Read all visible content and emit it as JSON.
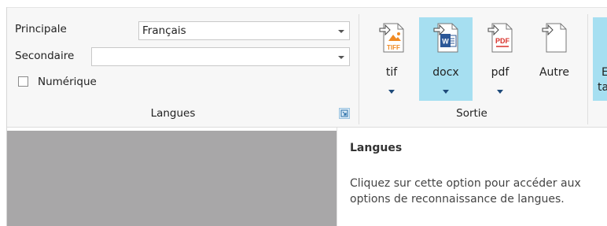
{
  "langues": {
    "principale_label": "Principale",
    "principale_value": "Français",
    "secondaire_label": "Secondaire",
    "secondaire_value": "",
    "numerique_label": "Numérique",
    "group_label": "Langues"
  },
  "sortie": {
    "group_label": "Sortie",
    "formats": [
      {
        "label": "tif",
        "icon": "tiff-file-icon",
        "badge": "TIFF",
        "has_dropdown": true,
        "selected": false
      },
      {
        "label": "docx",
        "icon": "word-file-icon",
        "badge": "W",
        "has_dropdown": true,
        "selected": true
      },
      {
        "label": "pdf",
        "icon": "pdf-file-icon",
        "badge": "PDF",
        "has_dropdown": true,
        "selected": false
      },
      {
        "label": "Autre",
        "icon": "generic-file-icon",
        "badge": "",
        "has_dropdown": false,
        "selected": false
      }
    ]
  },
  "next_group": {
    "label_line1": "E",
    "label_line2": "ta"
  },
  "tooltip": {
    "title": "Langues",
    "body": "Cliquez sur cette option pour accéder aux options de reconnaissance de langues."
  },
  "colors": {
    "ribbon_bg": "#f7f7f7",
    "selected_bg": "#a6dff1",
    "workspace_bg": "#a8a7a8",
    "tiff_orange": "#f08a24",
    "word_blue": "#2b5797",
    "pdf_red": "#d9312b"
  }
}
